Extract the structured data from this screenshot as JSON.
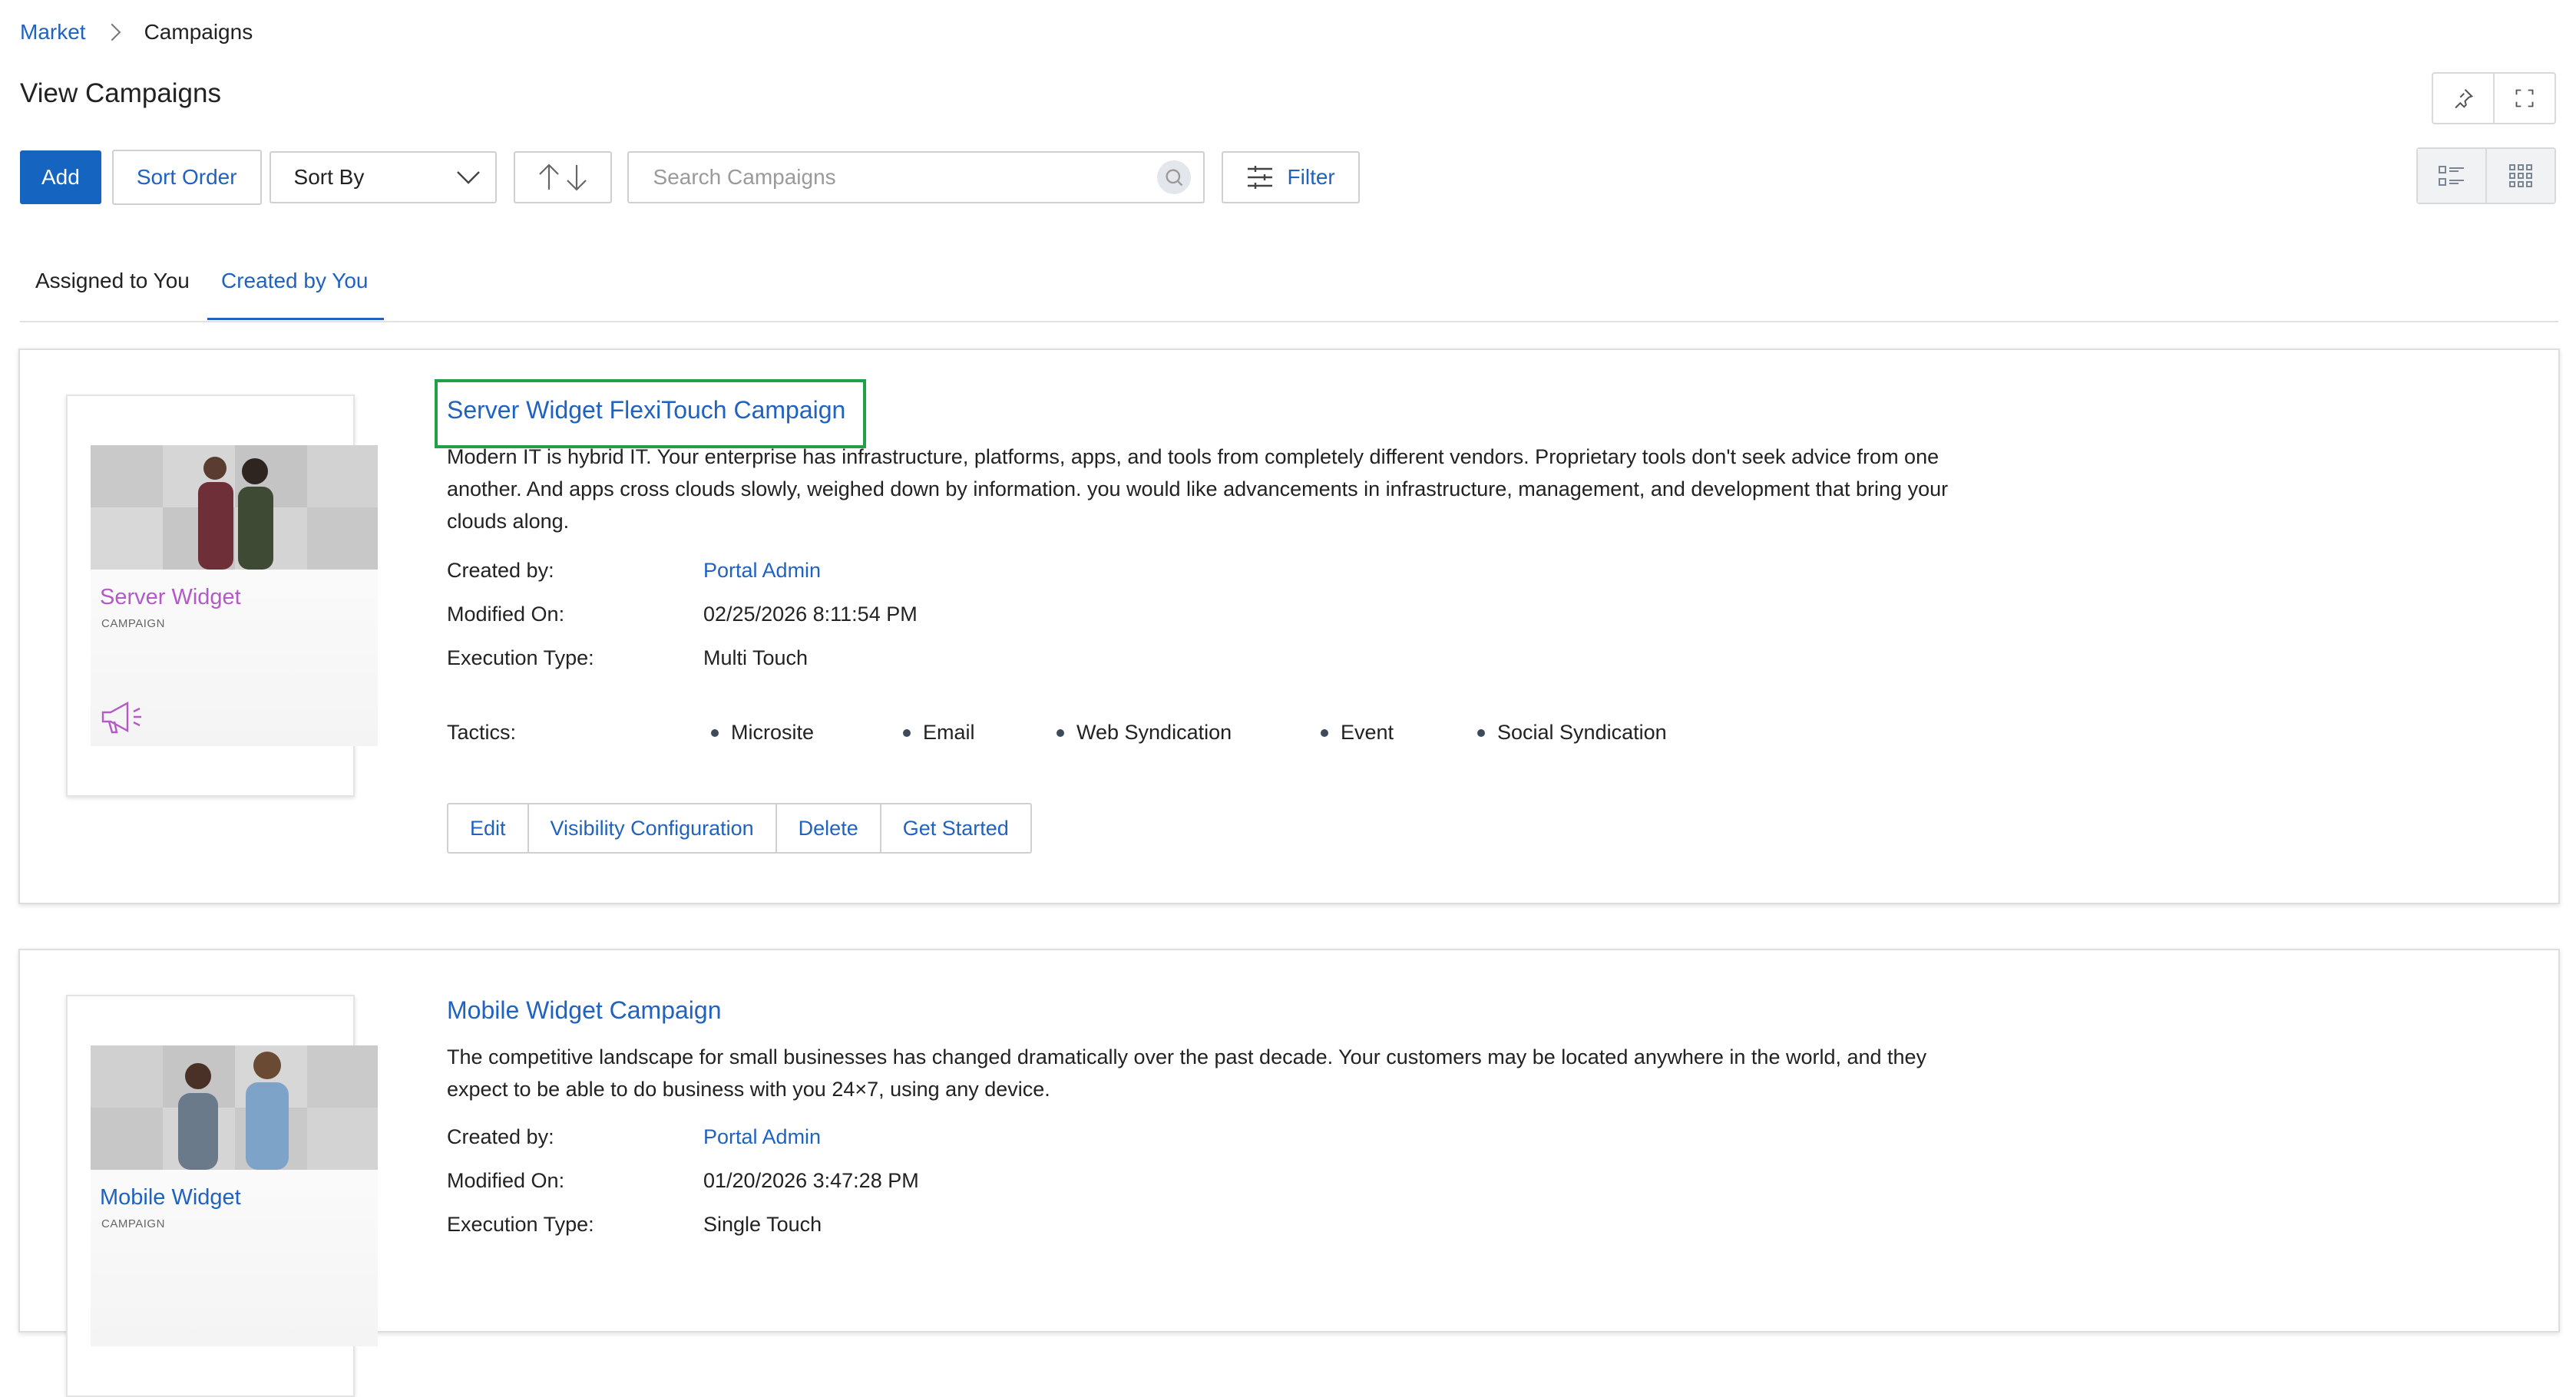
{
  "breadcrumb": {
    "parent": "Market",
    "current": "Campaigns"
  },
  "page_title": "View Campaigns",
  "toolbar": {
    "add_label": "Add",
    "sort_order_label": "Sort Order",
    "sort_by_label": "Sort By",
    "search_placeholder": "Search Campaigns",
    "filter_label": "Filter"
  },
  "tabs": [
    {
      "label": "Assigned to You",
      "active": false
    },
    {
      "label": "Created by You",
      "active": true
    }
  ],
  "labels": {
    "created_by": "Created by:",
    "modified_on": "Modified On:",
    "execution_type": "Execution Type:",
    "tactics": "Tactics:"
  },
  "campaigns": [
    {
      "title": "Server Widget FlexiTouch Campaign",
      "description": "Modern IT is hybrid IT. Your enterprise has infrastructure, platforms, apps, and tools from completely different vendors. Proprietary tools don't seek advice from one another. And apps cross clouds slowly, weighed down by information. you would like advancements in infrastructure, management, and development that bring your clouds along.",
      "thumb_title": "Server Widget",
      "thumb_sub": "CAMPAIGN",
      "thumb_color": "#b45ac8",
      "created_by": "Portal Admin",
      "modified_on": "02/25/2026 8:11:54 PM",
      "execution_type": "Multi Touch",
      "tactics": [
        "Microsite",
        "Email",
        "Web Syndication",
        "Event",
        "Social Syndication"
      ],
      "actions": [
        "Edit",
        "Visibility Configuration",
        "Delete",
        "Get Started"
      ],
      "highlighted": true
    },
    {
      "title": "Mobile Widget Campaign",
      "description": "The competitive landscape for small businesses has changed dramatically over the past decade. Your customers may be located anywhere in the world, and they expect to be able to do business with you 24×7, using any device.",
      "thumb_title": "Mobile Widget",
      "thumb_sub": "CAMPAIGN",
      "thumb_color": "#1f62c0",
      "created_by": "Portal Admin",
      "modified_on": "01/20/2026 3:47:28 PM",
      "execution_type": "Single Touch"
    }
  ],
  "colors": {
    "accent": "#1f62c0",
    "primary_button": "#1565c0",
    "highlight_box": "#22a045"
  },
  "icons": [
    "chevron-right-icon",
    "pin-icon",
    "fullscreen-icon",
    "chevron-down-icon",
    "sort-arrows-icon",
    "search-icon",
    "filter-sliders-icon",
    "list-view-icon",
    "grid-view-icon",
    "megaphone-icon"
  ]
}
